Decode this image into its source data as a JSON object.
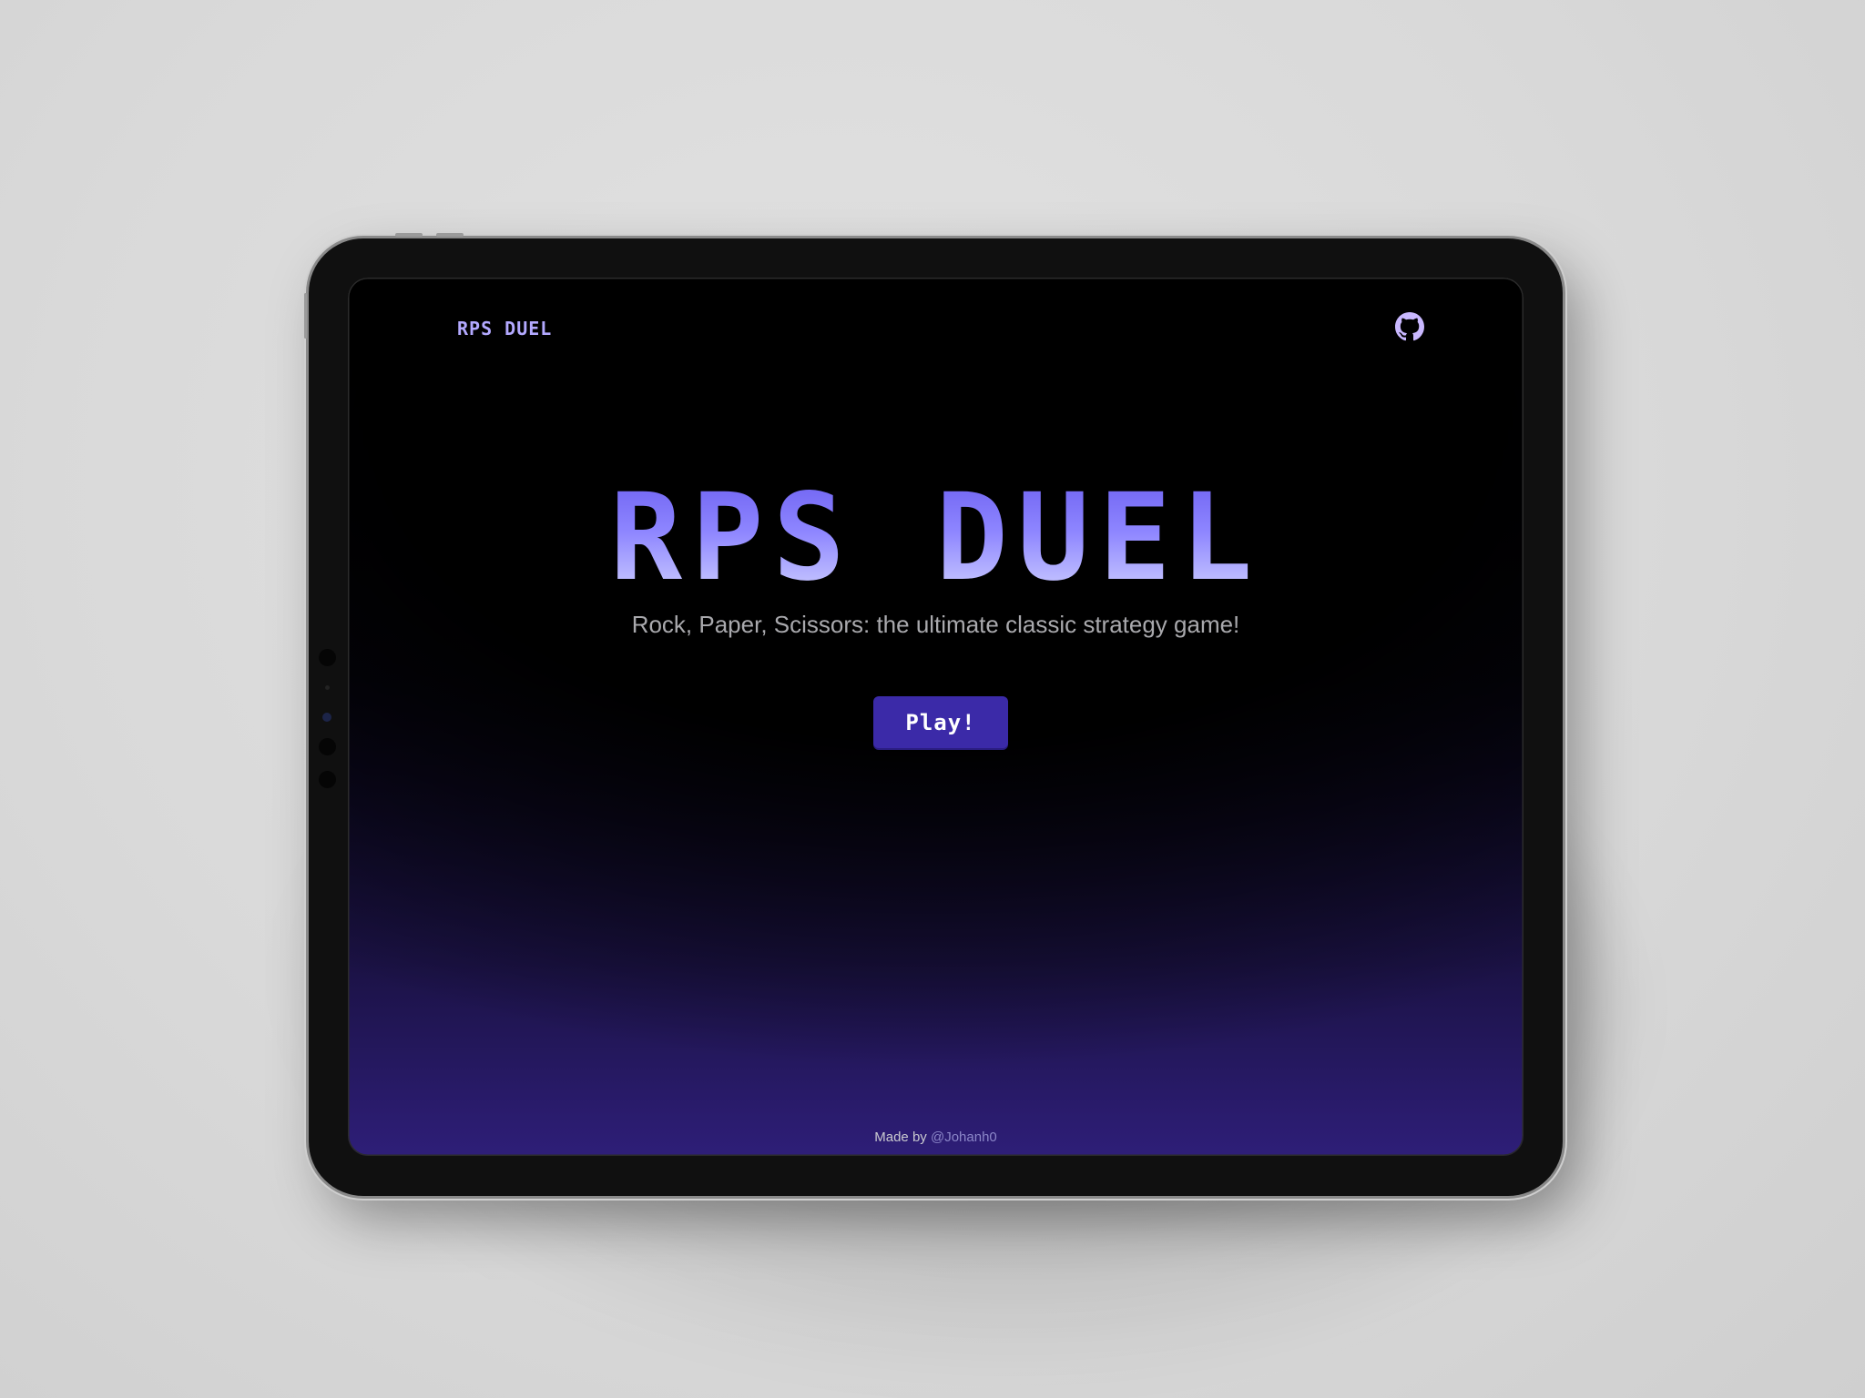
{
  "header": {
    "brand": "RPS DUEL",
    "github_icon": "github-icon"
  },
  "hero": {
    "title": "RPS DUEL",
    "subtitle": "Rock, Paper, Scissors: the ultimate classic strategy game!",
    "play_label": "Play!"
  },
  "footer": {
    "prefix": "Made by",
    "author": "@Johanh0"
  },
  "colors": {
    "accent": "#b3a9ff",
    "button": "#3b2aa8",
    "title_top": "#6f63f2",
    "title_bottom": "#cfd0ff",
    "background_bottom": "#2e1e78"
  }
}
